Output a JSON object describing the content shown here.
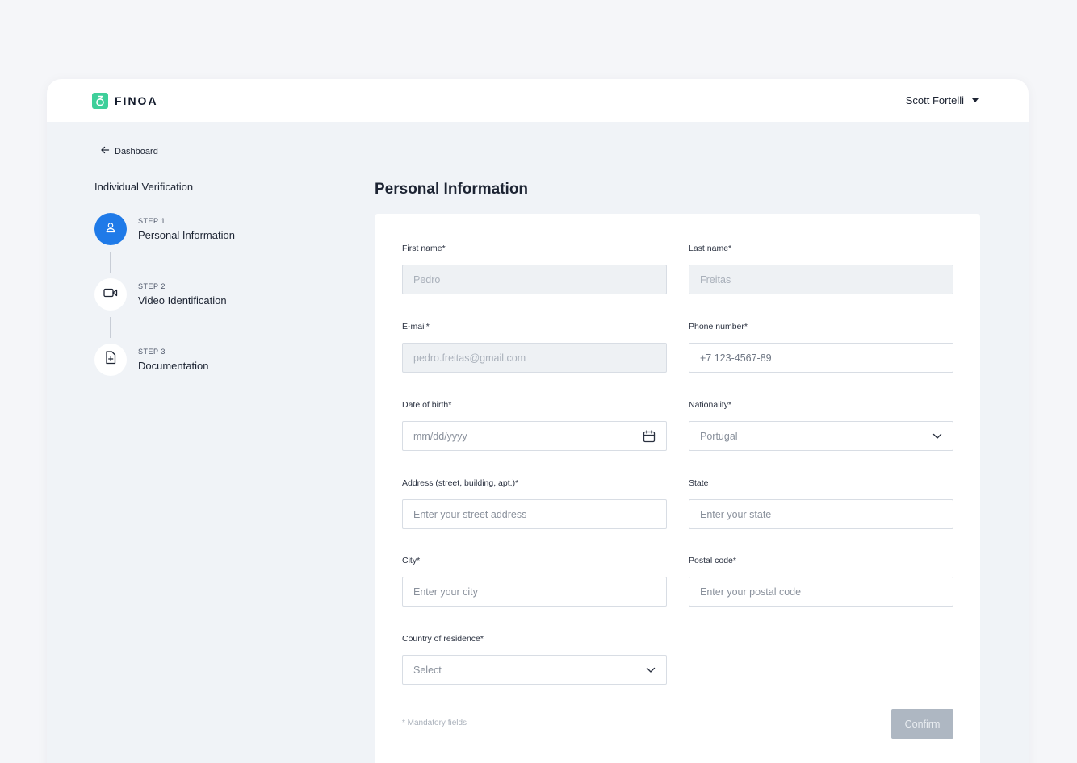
{
  "header": {
    "brand": "FINOA",
    "user_name": "Scott Fortelli"
  },
  "sidebar": {
    "back_label": "Dashboard",
    "title": "Individual Verification",
    "steps": [
      {
        "number": "STEP 1",
        "label": "Personal Information",
        "icon": "user-icon",
        "active": true
      },
      {
        "number": "STEP 2",
        "label": "Video Identification",
        "icon": "video-camera-icon",
        "active": false
      },
      {
        "number": "STEP 3",
        "label": "Documentation",
        "icon": "document-add-icon",
        "active": false
      }
    ]
  },
  "form": {
    "title": "Personal Information",
    "first_name": {
      "label": "First name*",
      "value": "Pedro"
    },
    "last_name": {
      "label": "Last name*",
      "value": "Freitas"
    },
    "email": {
      "label": "E-mail*",
      "value": "pedro.freitas@gmail.com"
    },
    "phone": {
      "label": "Phone number*",
      "value": "+7 123-4567-89"
    },
    "dob": {
      "label": "Date of birth*",
      "placeholder": "mm/dd/yyyy"
    },
    "nationality": {
      "label": "Nationality*",
      "value": "Portugal"
    },
    "address": {
      "label": "Address (street, building, apt.)*",
      "placeholder": "Enter your street address"
    },
    "state": {
      "label": "State",
      "placeholder": "Enter your state"
    },
    "city": {
      "label": "City*",
      "placeholder": "Enter your city"
    },
    "postal_code": {
      "label": "Postal code*",
      "placeholder": "Enter your postal code"
    },
    "country": {
      "label": "Country of residence*",
      "value": "Select"
    },
    "mandatory_note": "* Mandatory fields",
    "confirm_label": "Confirm"
  },
  "colors": {
    "accent": "#1f7ae8",
    "brand": "#3ecf9a",
    "disabled_button": "#aeb7c2"
  }
}
